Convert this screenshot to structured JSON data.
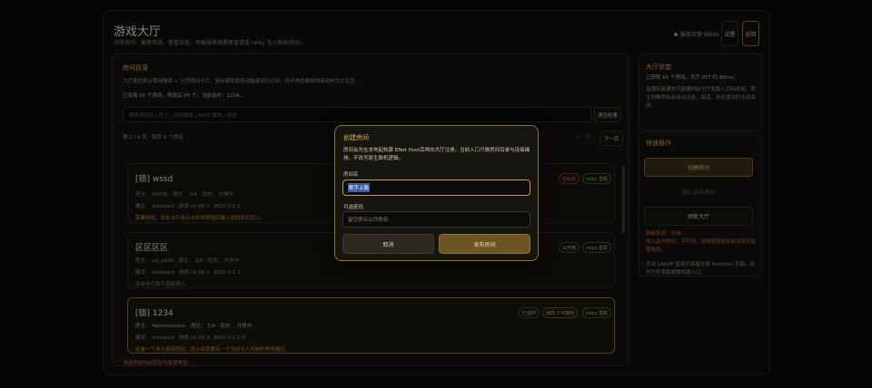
{
  "header": {
    "title": "游戏大厅",
    "subtitle": "浏览房间、搜索筛选、查看状态，并按服务器署者直连或 relay 加入联机房间。",
    "status": "服务正常 98ms",
    "settings_label": "设置",
    "back_label": "返回"
  },
  "room_directory": {
    "title": "房间目录",
    "desc": "大厅现在默认使用搜索 + 分页房间卡片，鼠标滚轮和移动端滚动仍可用，但不再依赖拖拽滚动作为主交互。",
    "summary": "已发现 65 个房间，筛选后 65 个。当前选中：1234。",
    "search_placeholder": "搜索房间名 / 房主 / 游戏版本 / MOD 版本 / 状态",
    "clear_search_label": "清空检索",
    "page_info": "第 1 / 9 页 · 每页 8 个房间",
    "prev_label": "上一页",
    "next_label": "下一页",
    "footer_note": "该组房间当前没有可接管角色。"
  },
  "rooms": [
    {
      "name": "[锁] wssd",
      "info": "房主： 64706 · 席位： 1/4 · 状态： 开放中",
      "meta": "模式： standard · 游戏 v0.98.3 · MOD 0.1.0",
      "note": "需要密码。双击卡片或点击右侧按钮后输入密码即可加入。",
      "tags": [
        "密码房",
        "relay 直联"
      ]
    },
    {
      "name": "区区区区",
      "info": "房主： ud_a436 · 席位： 1/4 · 状态： 开放中",
      "meta": "模式： standard · 游戏 v0.98.3 · MOD 0.1.2",
      "note": "双击卡片即可直接加入。",
      "tags": [
        "公开房",
        "relay 直联"
      ]
    },
    {
      "name": "[锁] 1234",
      "info": "房主： Administrator · 席位： 2/4 · 状态： 开放中",
      "meta": "模式： standard · 游戏 v0.98.3 · MOD 0.1.0.0",
      "note": "这是一个多人续局房间，加入前需要有一个当前无人控制的角色槽位。",
      "tags": [
        "已选中",
        "续局 0 可接管",
        "relay 直联"
      ]
    }
  ],
  "lobby_status": {
    "title": "大厅状态",
    "line1": "已获取 65 个房间，大厅 RTT 约 98ms。",
    "line2": "普通玩家通常只需要刷新大厅和加入目标房间，房主则推荐由会自动注册、保活，并在退出时主动关闭。"
  },
  "quick_actions": {
    "title": "快速操作",
    "create_label": "创建房间",
    "join_selected_label": "加入选中房间",
    "refresh_label": "刷新大厅",
    "status_text": "刷新房间：可用。\n加入选中房间：不可用，该续局房间当前没有可接管角色。",
    "hint": "手动 LAN/IP 直连仍保留在原 host/join 页面，仅作为开发和故障回退入口。"
  },
  "modal": {
    "title": "创建房间",
    "desc": "房间会先在本地起核慕 ENet Host后再向大厅注册。当前入口只做房间目录与连接编排，不改写原生联机逻辑。",
    "name_label": "房间名",
    "name_value": "默手上路",
    "password_label": "可选密码",
    "password_placeholder": "留空表示公开房间",
    "cancel_label": "取消",
    "publish_label": "发布房间"
  }
}
